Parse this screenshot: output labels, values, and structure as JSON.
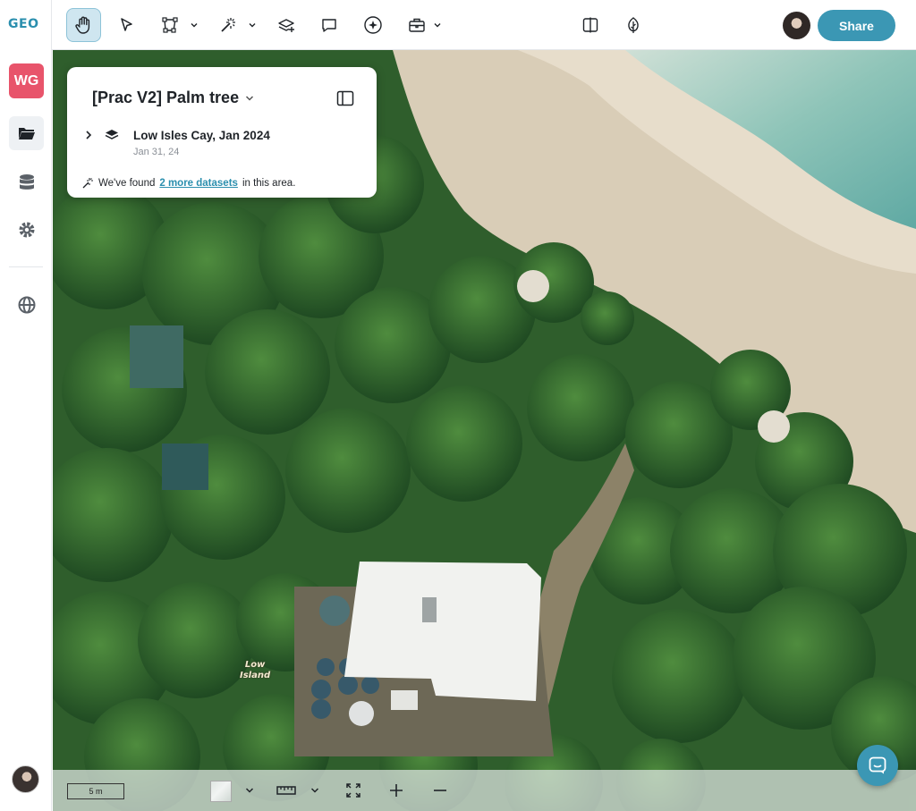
{
  "app": {
    "logo_text_a": "GE",
    "logo_text_b": "O",
    "workspace_initials": "WG",
    "accent_color": "#3b97b4",
    "workspace_color": "#e8546b"
  },
  "sidebar": {
    "items": [
      {
        "icon": "folder-icon",
        "active": true
      },
      {
        "icon": "database-icon",
        "active": false
      },
      {
        "icon": "gear-icon",
        "active": false
      },
      {
        "icon": "globe-icon",
        "active": false
      }
    ]
  },
  "toolbar": {
    "tools": [
      "hand-pan-icon",
      "pointer-icon",
      "polygon-select-icon",
      "magic-wand-icon",
      "add-layer-icon",
      "comment-icon",
      "ai-sparkle-icon",
      "toolbox-icon",
      "split-view-icon",
      "eco-leaf-icon"
    ],
    "share_label": "Share"
  },
  "panel": {
    "project_title": "[Prac V2] Palm tree",
    "dataset_name": "Low Isles Cay, Jan 2024",
    "dataset_date": "Jan 31, 24",
    "found_prefix": "We've found",
    "found_link": "2 more datasets",
    "found_suffix": "in this area."
  },
  "map": {
    "place_label_line1": "Low",
    "place_label_line2": "Island"
  },
  "bottombar": {
    "scale_label": "5 m"
  }
}
